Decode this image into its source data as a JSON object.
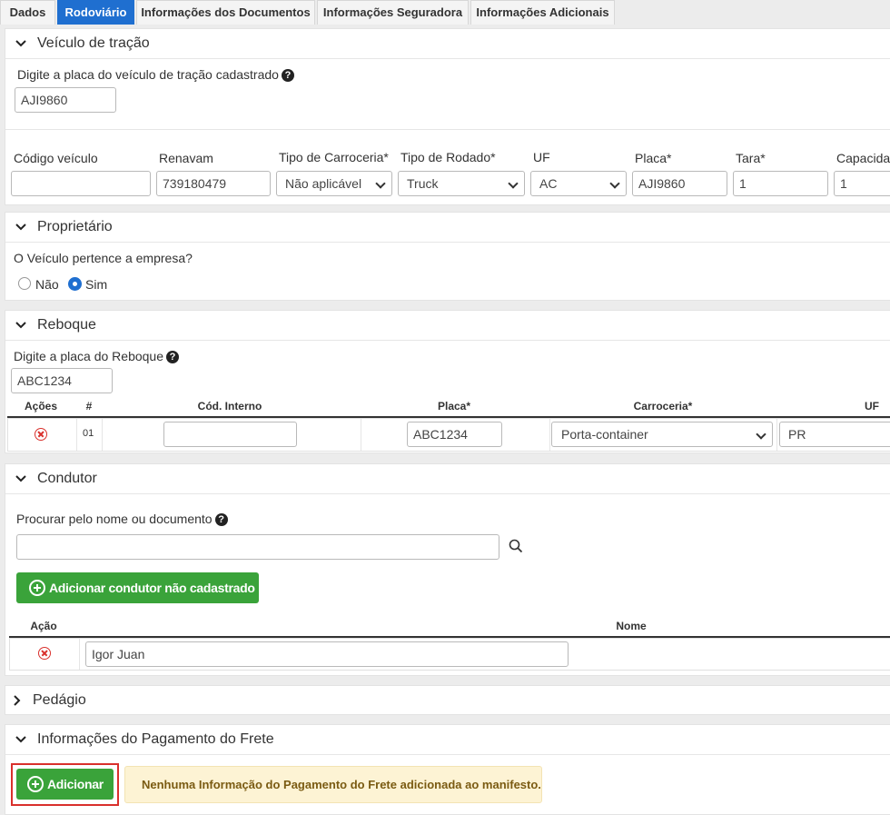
{
  "tabs": [
    "Dados",
    "Rodoviário",
    "Informações dos Documentos",
    "Informações Seguradora",
    "Informações Adicionais"
  ],
  "veiculo": {
    "title": "Veículo de tração",
    "placa_label": "Digite a placa do veículo de tração cadastrado",
    "placa_value": "AJI9860",
    "cols": {
      "codigo": "Código veículo",
      "renavam": "Renavam",
      "carroceria": "Tipo de Carroceria*",
      "rodado": "Tipo de Rodado*",
      "uf": "UF",
      "placa": "Placa*",
      "tara": "Tara*",
      "capacidade": "Capacida"
    },
    "values": {
      "codigo": "",
      "renavam": "739180479",
      "carroceria": "Não aplicável",
      "rodado": "Truck",
      "uf": "AC",
      "placa": "AJI9860",
      "tara": "1",
      "capacidade": "1"
    }
  },
  "proprietario": {
    "title": "Proprietário",
    "question": "O Veículo pertence a empresa?",
    "opt_nao": "Não",
    "opt_sim": "Sim",
    "selected": "Sim"
  },
  "reboque": {
    "title": "Reboque",
    "placa_label": "Digite a placa do Reboque",
    "placa_value": "ABC1234",
    "headers": {
      "acoes": "Ações",
      "num": "#",
      "cod": "Cód. Interno",
      "placa": "Placa*",
      "carroceria": "Carroceria*",
      "uf": "UF"
    },
    "row": {
      "num": "01",
      "cod": "",
      "placa": "ABC1234",
      "carroceria": "Porta-container",
      "uf": "PR"
    }
  },
  "condutor": {
    "title": "Condutor",
    "search_label": "Procurar pelo nome ou documento",
    "search_value": "",
    "add_button": "Adicionar condutor não cadastrado",
    "headers": {
      "acao": "Ação",
      "nome": "Nome"
    },
    "row": {
      "nome": "Igor Juan"
    }
  },
  "pedagio": {
    "title": "Pedágio"
  },
  "pagamento": {
    "title": "Informações do Pagamento do Frete",
    "add_button": "Adicionar",
    "message": "Nenhuma Informação do Pagamento do Frete adicionada ao manifesto."
  },
  "colors": {
    "primary": "#1f6fd0",
    "success": "#3aa33a",
    "danger": "#d9302c",
    "warning_bg": "#fdf3d4",
    "warning_text": "#7a5b12"
  }
}
